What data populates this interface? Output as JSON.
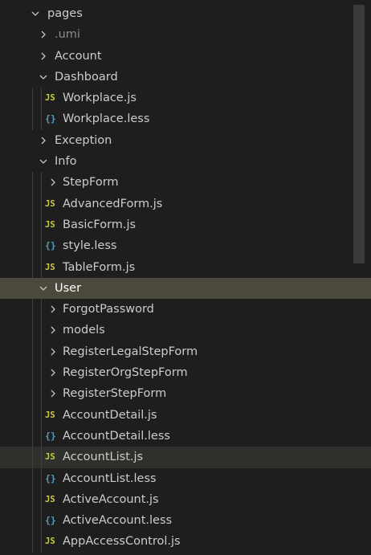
{
  "explorer": {
    "items": [
      {
        "label": "pages",
        "kind": "folder",
        "depth": 0,
        "expanded": true
      },
      {
        "label": ".umi",
        "kind": "folder",
        "depth": 1,
        "expanded": false,
        "dim": true
      },
      {
        "label": "Account",
        "kind": "folder",
        "depth": 1,
        "expanded": false
      },
      {
        "label": "Dashboard",
        "kind": "folder",
        "depth": 1,
        "expanded": true
      },
      {
        "label": "Workplace.js",
        "kind": "js",
        "depth": 2
      },
      {
        "label": "Workplace.less",
        "kind": "less",
        "depth": 2
      },
      {
        "label": "Exception",
        "kind": "folder",
        "depth": 1,
        "expanded": false
      },
      {
        "label": "Info",
        "kind": "folder",
        "depth": 1,
        "expanded": true
      },
      {
        "label": "StepForm",
        "kind": "folder",
        "depth": 2,
        "expanded": false
      },
      {
        "label": "AdvancedForm.js",
        "kind": "js",
        "depth": 2
      },
      {
        "label": "BasicForm.js",
        "kind": "js",
        "depth": 2
      },
      {
        "label": "style.less",
        "kind": "less",
        "depth": 2
      },
      {
        "label": "TableForm.js",
        "kind": "js",
        "depth": 2
      },
      {
        "label": "User",
        "kind": "folder",
        "depth": 1,
        "expanded": true,
        "selected": true
      },
      {
        "label": "ForgotPassword",
        "kind": "folder",
        "depth": 2,
        "expanded": false
      },
      {
        "label": "models",
        "kind": "folder",
        "depth": 2,
        "expanded": false
      },
      {
        "label": "RegisterLegalStepForm",
        "kind": "folder",
        "depth": 2,
        "expanded": false
      },
      {
        "label": "RegisterOrgStepForm",
        "kind": "folder",
        "depth": 2,
        "expanded": false
      },
      {
        "label": "RegisterStepForm",
        "kind": "folder",
        "depth": 2,
        "expanded": false
      },
      {
        "label": "AccountDetail.js",
        "kind": "js",
        "depth": 2
      },
      {
        "label": "AccountDetail.less",
        "kind": "less",
        "depth": 2
      },
      {
        "label": "AccountList.js",
        "kind": "js",
        "depth": 2,
        "hover": true
      },
      {
        "label": "AccountList.less",
        "kind": "less",
        "depth": 2
      },
      {
        "label": "ActiveAccount.js",
        "kind": "js",
        "depth": 2
      },
      {
        "label": "ActiveAccount.less",
        "kind": "less",
        "depth": 2
      },
      {
        "label": "AppAccessControl.js",
        "kind": "js",
        "depth": 2
      }
    ]
  },
  "icons": {
    "js": "JS",
    "less": "{}"
  },
  "colors": {
    "background": "#1e1e1e",
    "selected_row": "#4b493b",
    "js_icon": "#cbcb41",
    "less_icon": "#519aba"
  }
}
